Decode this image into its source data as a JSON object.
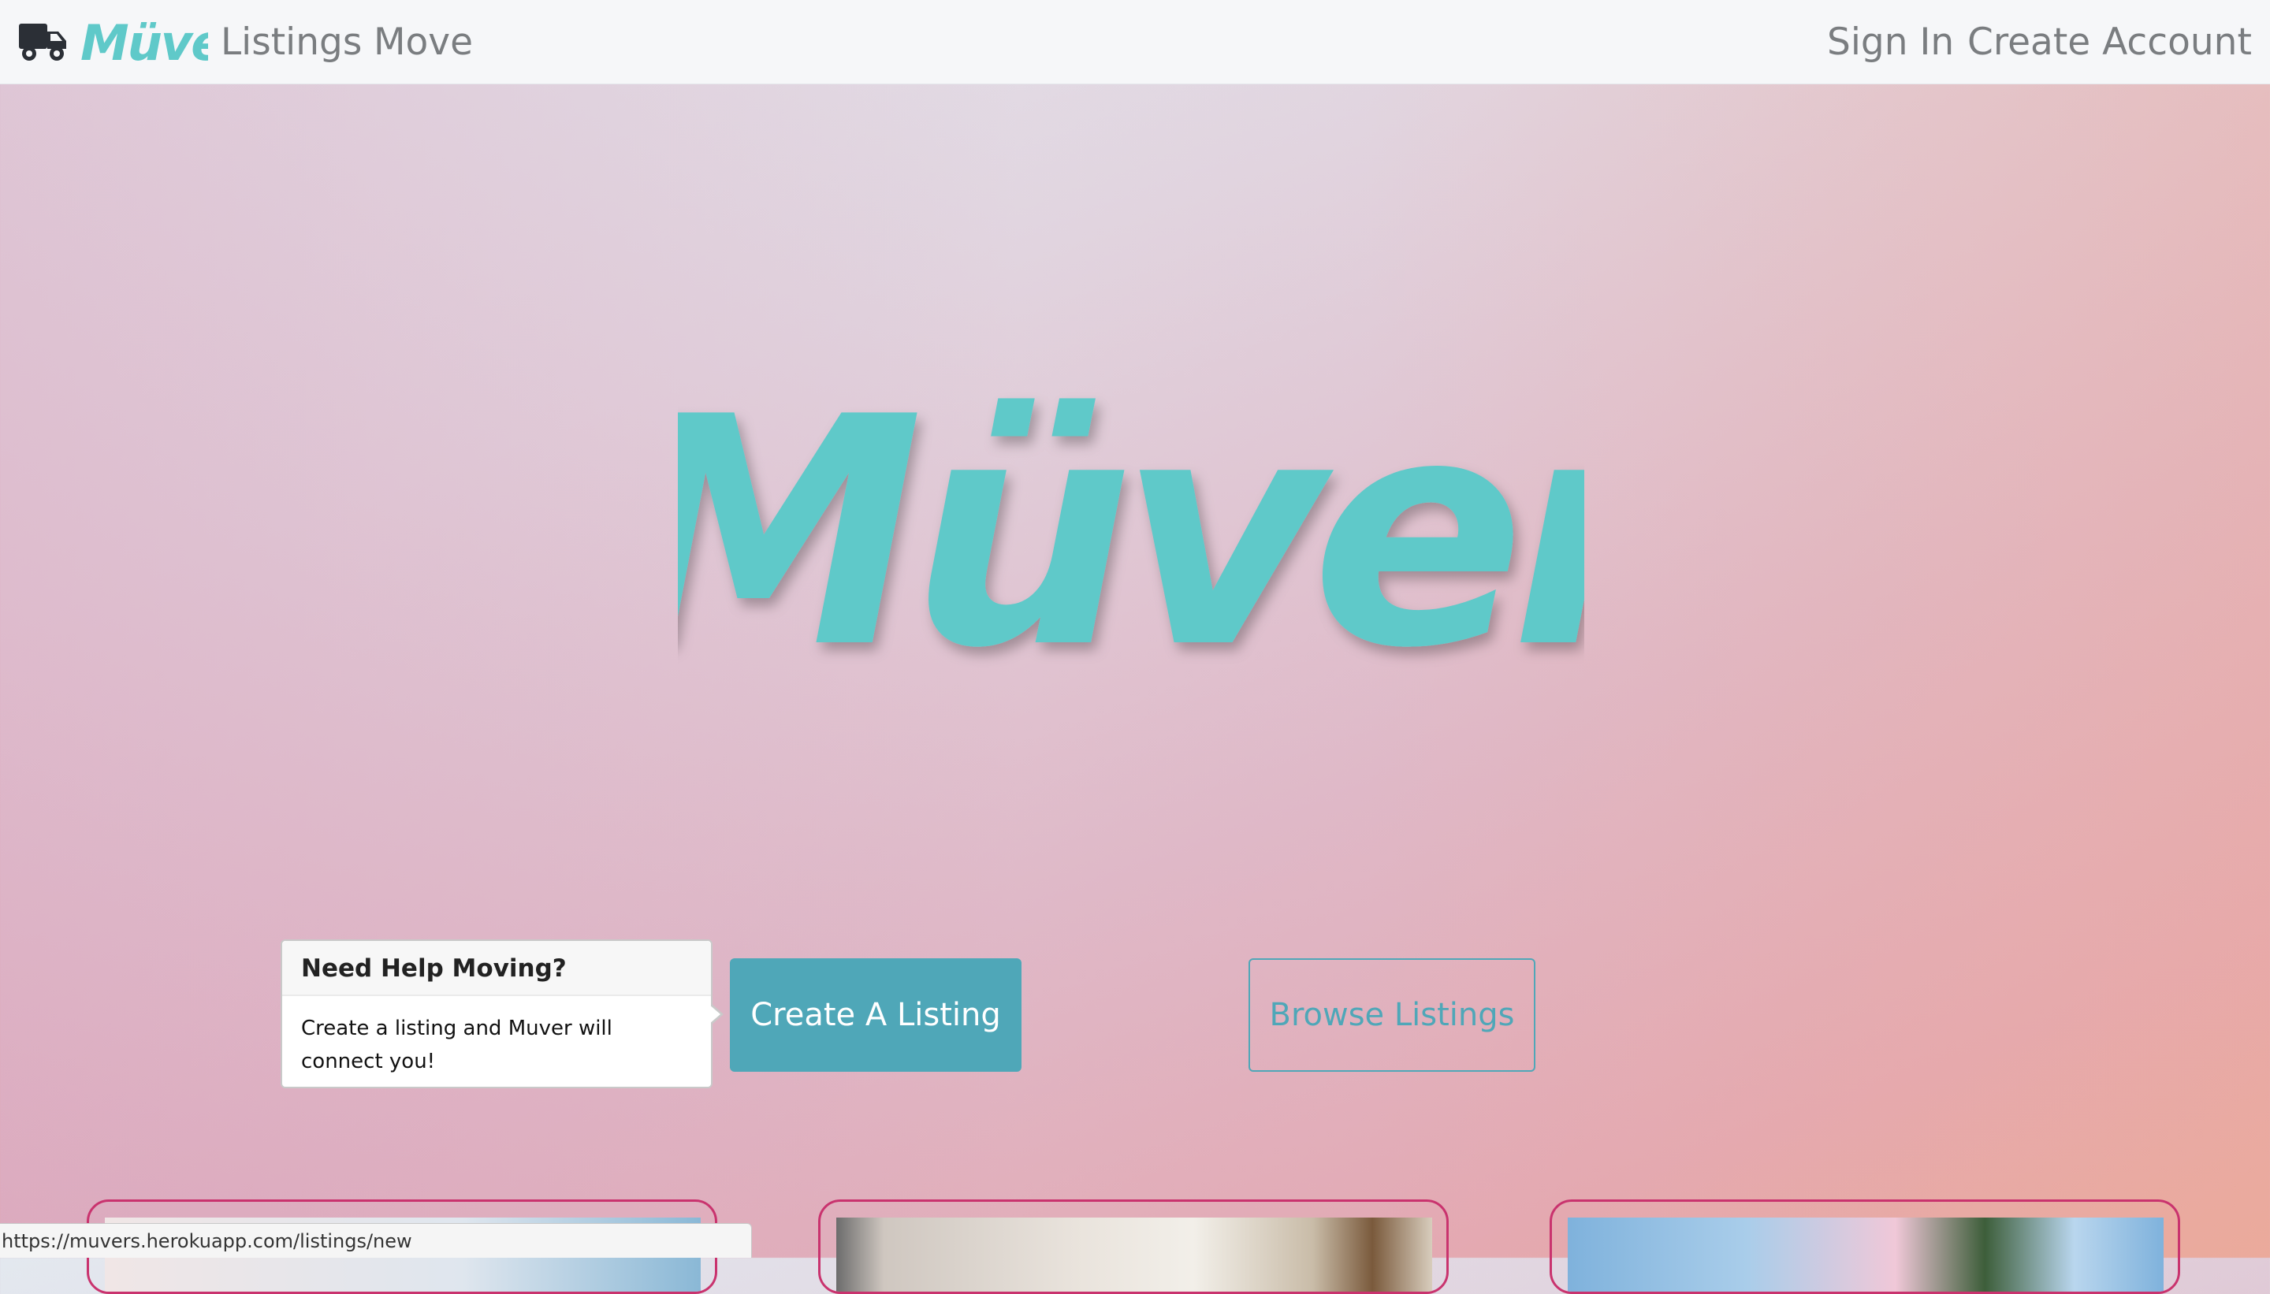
{
  "nav": {
    "brand_icon": "truck-icon",
    "brand_logo": "Müver",
    "links_left": [
      "Listings",
      "Move"
    ],
    "links_right": [
      "Sign In",
      "Create Account"
    ]
  },
  "hero": {
    "logo_text": "Müver",
    "logo_color": "#5fc9c9"
  },
  "popover": {
    "title": "Need Help Moving?",
    "body": "Create a listing and Muver will connect you!"
  },
  "buttons": {
    "create": "Create A Listing",
    "browse": "Browse Listings"
  },
  "colors": {
    "accent": "#4fa7b8",
    "card_border": "#c9336e",
    "brand": "#5fc9c9"
  },
  "status_bar": {
    "url": "https://muvers.herokuapp.com/listings/new"
  }
}
